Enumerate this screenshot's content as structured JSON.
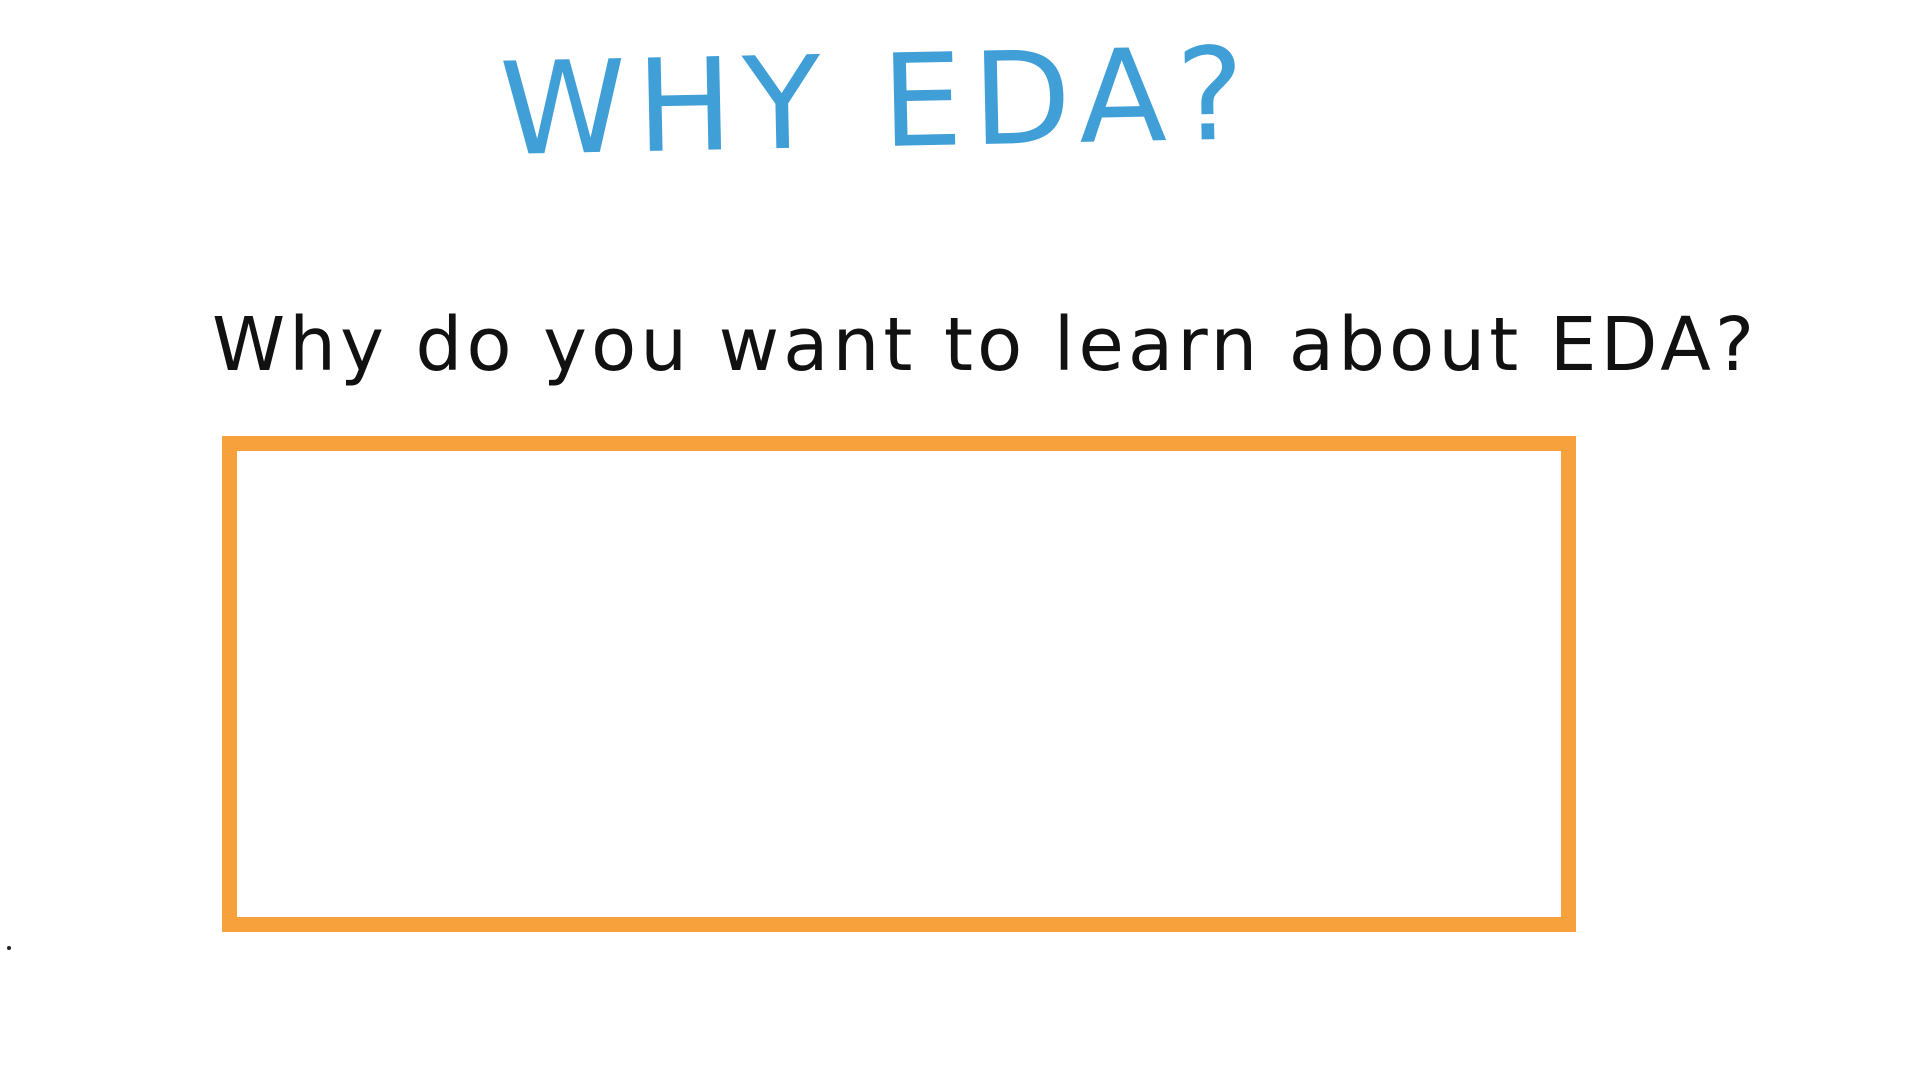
{
  "slide": {
    "title": "WHY EDA?",
    "question": "Why do you want to learn about EDA?",
    "answer_box": {
      "value": ""
    }
  },
  "colors": {
    "title": "#3f9fd6",
    "question": "#111111",
    "answer_box_border": "#f7a13c",
    "background": "#ffffff"
  }
}
